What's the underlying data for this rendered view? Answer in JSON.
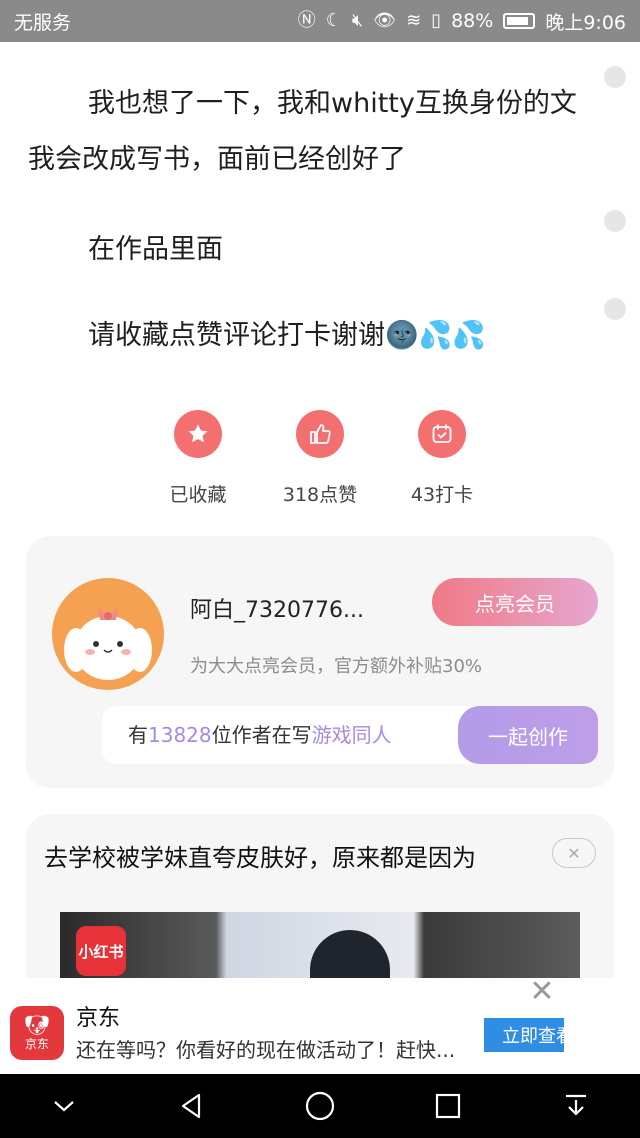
{
  "status_bar": {
    "carrier": "无服务",
    "battery": "88%",
    "battery_level": 0.88,
    "time": "晚上9:06",
    "icons": [
      "nfc-icon",
      "moon-icon",
      "mute-icon",
      "eye-icon",
      "wifi-icon",
      "sim-alert-icon",
      "battery-icon"
    ]
  },
  "article": {
    "paragraph1": "我也想了一下，我和whitty互换身份的文我会改成写书，面前已经创好了",
    "paragraph2": "在作品里面",
    "paragraph3": "请收藏点赞评论打卡谢谢",
    "paragraph3_emoji": "🌚💦💦"
  },
  "actions": [
    {
      "icon": "star-icon",
      "label": "已收藏"
    },
    {
      "icon": "thumbs-up-icon",
      "label": "318点赞"
    },
    {
      "icon": "calendar-check-icon",
      "label": "43打卡"
    }
  ],
  "author_card": {
    "username": "阿白_7320776...",
    "vip_button": "点亮会员",
    "subline": "为大大点亮会员，官方额外补贴30%",
    "writer_prefix": "有",
    "writer_count": "13828",
    "writer_mid": "位作者在写",
    "writer_topic": "游戏同人",
    "create_button": "一起创作"
  },
  "ad_card": {
    "title": "去学校被学妹直夸皮肤好，原来都是因为",
    "close": "✕",
    "brand_badge": "小红书"
  },
  "bottom_ad": {
    "logo_text": "京东",
    "name": "京东",
    "desc": "还在等吗？你看好的现在做活动了！赶快...",
    "button": "立即查看",
    "close": "✕"
  },
  "colors": {
    "accent_red": "#f36f70",
    "vip_pink": "#f07a86",
    "purple": "#b49be8",
    "jd_red": "#e4393c",
    "jd_blue": "#2f8de4"
  }
}
